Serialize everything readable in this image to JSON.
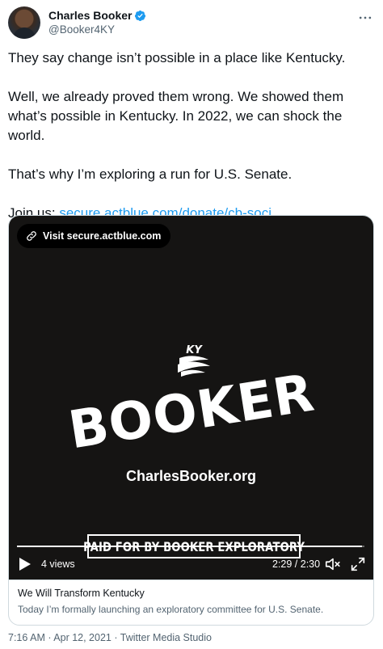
{
  "author": {
    "name": "Charles Booker",
    "handle": "@Booker4KY"
  },
  "tweet": {
    "paragraphs": [
      "They say change isn’t possible in a place like Kentucky.",
      "Well, we already proved them wrong. We showed them what’s possible in Kentucky. In 2022, we can shock the world.",
      "That’s why I’m exploring a run for U.S. Senate."
    ],
    "join_prefix": "Join us: ",
    "link_text": "secure.actblue.com/donate/cb-soci…"
  },
  "video": {
    "visit_label": "Visit secure.actblue.com",
    "logo_ky": "KY",
    "logo_word": "BOOKER",
    "site_text": "CharlesBooker.org",
    "paid_for": "PAID FOR BY BOOKER EXPLORATORY",
    "views": "4 views",
    "time": "2:29 / 2:30",
    "progress": 0.993
  },
  "card": {
    "title": "We Will Transform Kentucky",
    "description": "Today I’m formally launching an exploratory committee for U.S. Senate."
  },
  "meta": {
    "timestamp": "7:16 AM · Apr 12, 2021 · Twitter Media Studio"
  },
  "colors": {
    "link": "#1d9bf0",
    "verified": "#1d9bf0",
    "video_bg": "#151413",
    "secondary_text": "#536471"
  },
  "icons": {
    "verified": "verified-badge-icon",
    "more": "more-options-icon",
    "link": "link-icon",
    "play": "play-icon",
    "volume": "volume-muted-icon",
    "fullscreen": "fullscreen-icon",
    "logo": "booker-campaign-logo"
  }
}
